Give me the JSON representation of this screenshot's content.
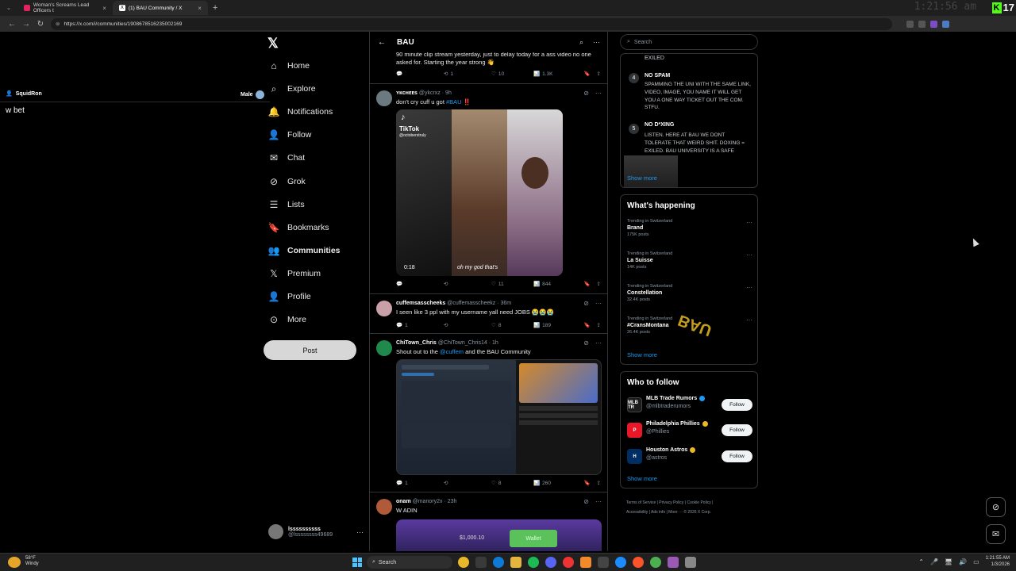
{
  "browser": {
    "tabs": [
      {
        "title": "Woman's Screams Lead Officers t",
        "color": "#e0245e",
        "active": false
      },
      {
        "title": "(1) BAU Community / X",
        "color": "#ffffff",
        "active": true
      }
    ],
    "url": "https://x.com/i/communities/1908678516235002169",
    "clock": "1:21:56 am",
    "kick_count": "17"
  },
  "stream_overlay": {
    "username": "SquidRon",
    "gender_label": "Male",
    "chat_message": "w bet"
  },
  "x_nav": {
    "logo": "𝕏",
    "items": [
      {
        "label": "Home",
        "icon": "home-icon",
        "glyph": "⌂"
      },
      {
        "label": "Explore",
        "icon": "search-icon",
        "glyph": "⌕"
      },
      {
        "label": "Notifications",
        "icon": "bell-icon",
        "glyph": "🔔"
      },
      {
        "label": "Follow",
        "icon": "follow-icon",
        "glyph": "👤"
      },
      {
        "label": "Chat",
        "icon": "mail-icon",
        "glyph": "✉"
      },
      {
        "label": "Grok",
        "icon": "grok-icon",
        "glyph": "⊘"
      },
      {
        "label": "Lists",
        "icon": "lists-icon",
        "glyph": "☰"
      },
      {
        "label": "Bookmarks",
        "icon": "bookmark-icon",
        "glyph": "🔖"
      },
      {
        "label": "Communities",
        "icon": "communities-icon",
        "glyph": "👥"
      },
      {
        "label": "Premium",
        "icon": "premium-icon",
        "glyph": "𝕏"
      },
      {
        "label": "Profile",
        "icon": "profile-icon",
        "glyph": "👤"
      },
      {
        "label": "More",
        "icon": "more-icon",
        "glyph": "⊙"
      }
    ],
    "post_button": "Post",
    "account": {
      "name": "lssssssssss",
      "handle": "@lssssssss49689"
    }
  },
  "timeline": {
    "title": "BAU",
    "posts": [
      {
        "text": "90 minute clip stream yesterday, just to delay today for a ass video no one asked for. Starting the year strong 👋",
        "replies": "",
        "reposts": "1",
        "likes": "10",
        "views": "1.3K"
      },
      {
        "name": "ʏᴋᴄʜᴇᴇs",
        "handle": "@ykcrxz",
        "time": "9h",
        "text_pre": "don't cry cuff u got ",
        "tag": "#BAU",
        "text_post": " ‼️",
        "video_brand": "TikTok",
        "video_user": "@octoberstruly",
        "video_time": "0:18",
        "video_caption": "oh my god that's",
        "replies": "",
        "reposts": "",
        "likes": "11",
        "views": "844"
      },
      {
        "name": "cuffemsasscheeks",
        "handle": "@cuffemasscheekz",
        "time": "36m",
        "text": "I seen like 3 ppl with my username yall need JOBS 😭😭😭",
        "replies": "1",
        "reposts": "",
        "likes": "8",
        "views": "189"
      },
      {
        "name": "ChiTown_Chris",
        "handle": "@ChiTown_Chris14",
        "time": "1h",
        "text_pre": "Shout out to the ",
        "mention": "@cuffem",
        "text_post": " and the BAU Community",
        "replies": "1",
        "reposts": "",
        "likes": "8",
        "views": "260"
      },
      {
        "name": "onam",
        "handle": "@manory2x",
        "time": "23h",
        "text": "W ADIN",
        "wallet_amount": "$1,000.10",
        "wallet_label": "Wallet"
      }
    ]
  },
  "sidebar": {
    "search_placeholder": "Search",
    "rules": {
      "exiled": "EXILED",
      "items": [
        {
          "num": "4",
          "title": "NO SPAM",
          "body": "SPAMMING THE UNI WITH THE SAME LINK, VIDEO, IMAGE, YOU NAME IT WILL GET YOU A ONE WAY TICKET OUT THE COM. STFU."
        },
        {
          "num": "5",
          "title": "NO D*XING",
          "body": "LISTEN. HERE AT BAU WE DONT TOLERATE THAT WEIRD SHIT. DOXING = EXILED. BAU UNIVERSITY IS A SAFE"
        }
      ],
      "show_more": "Show more"
    },
    "happening": {
      "title": "What's happening",
      "trends": [
        {
          "context": "Trending in Switzerland",
          "name": "Brand",
          "count": "175K posts"
        },
        {
          "context": "Trending in Switzerland",
          "name": "La Suisse",
          "count": "14K posts"
        },
        {
          "context": "Trending in Switzerland",
          "name": "Constellation",
          "count": "32.4K posts"
        },
        {
          "context": "Trending in Switzerland",
          "name": "#CransMontana",
          "count": "26.4K posts"
        }
      ],
      "show_more": "Show more",
      "overlay_logo_text": "BAU"
    },
    "who_to_follow": {
      "title": "Who to follow",
      "accounts": [
        {
          "name": "MLB Trade Rumors",
          "handle": "@mlbtraderumors",
          "badge": "#1d9bf0",
          "avatar_text": "MLB TR",
          "avatar_color": "#1b1b1b"
        },
        {
          "name": "Philadelphia Phillies",
          "handle": "@Phillies",
          "badge": "#e8b923",
          "avatar_text": "P",
          "avatar_color": "#e81828"
        },
        {
          "name": "Houston Astros",
          "handle": "@astros",
          "badge": "#e8b923",
          "avatar_text": "H",
          "avatar_color": "#002d62"
        }
      ],
      "follow_label": "Follow",
      "show_more": "Show more"
    },
    "footer": {
      "line1": "Terms of Service  |  Privacy Policy  |  Cookie Policy  |",
      "line2": "Accessibility  |  Ads info  |  More ···  © 2026 X Corp."
    }
  },
  "taskbar": {
    "weather_temp": "58°F",
    "weather_desc": "Windy",
    "search_placeholder": "Search",
    "time": "1:21:55 AM",
    "date": "1/3/2026"
  }
}
